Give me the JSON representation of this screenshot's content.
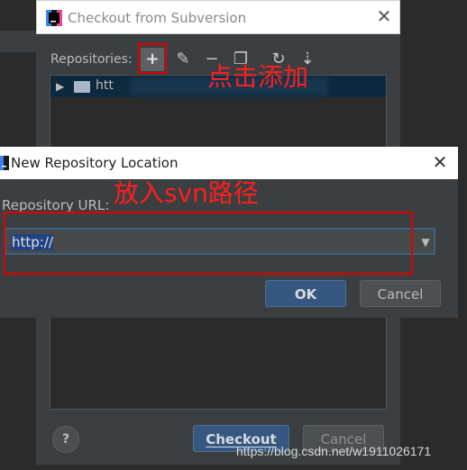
{
  "outer_dialog": {
    "title": "Checkout from Subversion",
    "repositories_label": "Repositories:",
    "tree_row_text": "htt",
    "help_label": "?",
    "checkout_label": "Checkout",
    "cancel_label": "Cancel"
  },
  "toolbar": {
    "add_icon": "+",
    "edit_icon": "✎",
    "remove_icon": "−",
    "copy_icon": "❐",
    "refresh_icon": "↻",
    "more_icon": "⇣"
  },
  "inner_dialog": {
    "title": "New Repository Location",
    "url_label": "Repository URL:",
    "url_value": "http://",
    "ok_label": "OK",
    "cancel_label": "Cancel"
  },
  "annotations": {
    "add_note": "点击添加",
    "path_note": "放入svn路径"
  },
  "watermark": "https://blog.csdn.net/w1911026171",
  "colors": {
    "annotation": "#ff1e1e",
    "primary_button": "#365880",
    "dialog_bg": "#3c3f41",
    "selection": "#0d293e"
  }
}
